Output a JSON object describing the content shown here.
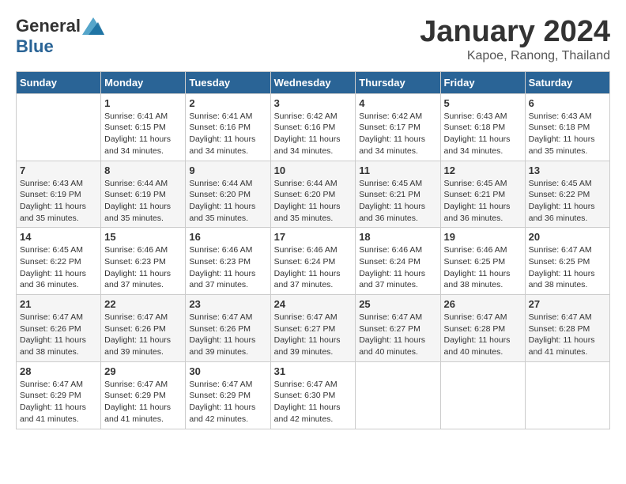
{
  "header": {
    "logo_general": "General",
    "logo_blue": "Blue",
    "month_title": "January 2024",
    "location": "Kapoe, Ranong, Thailand"
  },
  "days_of_week": [
    "Sunday",
    "Monday",
    "Tuesday",
    "Wednesday",
    "Thursday",
    "Friday",
    "Saturday"
  ],
  "weeks": [
    [
      {
        "day": "",
        "info": ""
      },
      {
        "day": "1",
        "info": "Sunrise: 6:41 AM\nSunset: 6:15 PM\nDaylight: 11 hours\nand 34 minutes."
      },
      {
        "day": "2",
        "info": "Sunrise: 6:41 AM\nSunset: 6:16 PM\nDaylight: 11 hours\nand 34 minutes."
      },
      {
        "day": "3",
        "info": "Sunrise: 6:42 AM\nSunset: 6:16 PM\nDaylight: 11 hours\nand 34 minutes."
      },
      {
        "day": "4",
        "info": "Sunrise: 6:42 AM\nSunset: 6:17 PM\nDaylight: 11 hours\nand 34 minutes."
      },
      {
        "day": "5",
        "info": "Sunrise: 6:43 AM\nSunset: 6:18 PM\nDaylight: 11 hours\nand 34 minutes."
      },
      {
        "day": "6",
        "info": "Sunrise: 6:43 AM\nSunset: 6:18 PM\nDaylight: 11 hours\nand 35 minutes."
      }
    ],
    [
      {
        "day": "7",
        "info": "Sunrise: 6:43 AM\nSunset: 6:19 PM\nDaylight: 11 hours\nand 35 minutes."
      },
      {
        "day": "8",
        "info": "Sunrise: 6:44 AM\nSunset: 6:19 PM\nDaylight: 11 hours\nand 35 minutes."
      },
      {
        "day": "9",
        "info": "Sunrise: 6:44 AM\nSunset: 6:20 PM\nDaylight: 11 hours\nand 35 minutes."
      },
      {
        "day": "10",
        "info": "Sunrise: 6:44 AM\nSunset: 6:20 PM\nDaylight: 11 hours\nand 35 minutes."
      },
      {
        "day": "11",
        "info": "Sunrise: 6:45 AM\nSunset: 6:21 PM\nDaylight: 11 hours\nand 36 minutes."
      },
      {
        "day": "12",
        "info": "Sunrise: 6:45 AM\nSunset: 6:21 PM\nDaylight: 11 hours\nand 36 minutes."
      },
      {
        "day": "13",
        "info": "Sunrise: 6:45 AM\nSunset: 6:22 PM\nDaylight: 11 hours\nand 36 minutes."
      }
    ],
    [
      {
        "day": "14",
        "info": "Sunrise: 6:45 AM\nSunset: 6:22 PM\nDaylight: 11 hours\nand 36 minutes."
      },
      {
        "day": "15",
        "info": "Sunrise: 6:46 AM\nSunset: 6:23 PM\nDaylight: 11 hours\nand 37 minutes."
      },
      {
        "day": "16",
        "info": "Sunrise: 6:46 AM\nSunset: 6:23 PM\nDaylight: 11 hours\nand 37 minutes."
      },
      {
        "day": "17",
        "info": "Sunrise: 6:46 AM\nSunset: 6:24 PM\nDaylight: 11 hours\nand 37 minutes."
      },
      {
        "day": "18",
        "info": "Sunrise: 6:46 AM\nSunset: 6:24 PM\nDaylight: 11 hours\nand 37 minutes."
      },
      {
        "day": "19",
        "info": "Sunrise: 6:46 AM\nSunset: 6:25 PM\nDaylight: 11 hours\nand 38 minutes."
      },
      {
        "day": "20",
        "info": "Sunrise: 6:47 AM\nSunset: 6:25 PM\nDaylight: 11 hours\nand 38 minutes."
      }
    ],
    [
      {
        "day": "21",
        "info": "Sunrise: 6:47 AM\nSunset: 6:26 PM\nDaylight: 11 hours\nand 38 minutes."
      },
      {
        "day": "22",
        "info": "Sunrise: 6:47 AM\nSunset: 6:26 PM\nDaylight: 11 hours\nand 39 minutes."
      },
      {
        "day": "23",
        "info": "Sunrise: 6:47 AM\nSunset: 6:26 PM\nDaylight: 11 hours\nand 39 minutes."
      },
      {
        "day": "24",
        "info": "Sunrise: 6:47 AM\nSunset: 6:27 PM\nDaylight: 11 hours\nand 39 minutes."
      },
      {
        "day": "25",
        "info": "Sunrise: 6:47 AM\nSunset: 6:27 PM\nDaylight: 11 hours\nand 40 minutes."
      },
      {
        "day": "26",
        "info": "Sunrise: 6:47 AM\nSunset: 6:28 PM\nDaylight: 11 hours\nand 40 minutes."
      },
      {
        "day": "27",
        "info": "Sunrise: 6:47 AM\nSunset: 6:28 PM\nDaylight: 11 hours\nand 41 minutes."
      }
    ],
    [
      {
        "day": "28",
        "info": "Sunrise: 6:47 AM\nSunset: 6:29 PM\nDaylight: 11 hours\nand 41 minutes."
      },
      {
        "day": "29",
        "info": "Sunrise: 6:47 AM\nSunset: 6:29 PM\nDaylight: 11 hours\nand 41 minutes."
      },
      {
        "day": "30",
        "info": "Sunrise: 6:47 AM\nSunset: 6:29 PM\nDaylight: 11 hours\nand 42 minutes."
      },
      {
        "day": "31",
        "info": "Sunrise: 6:47 AM\nSunset: 6:30 PM\nDaylight: 11 hours\nand 42 minutes."
      },
      {
        "day": "",
        "info": ""
      },
      {
        "day": "",
        "info": ""
      },
      {
        "day": "",
        "info": ""
      }
    ]
  ]
}
